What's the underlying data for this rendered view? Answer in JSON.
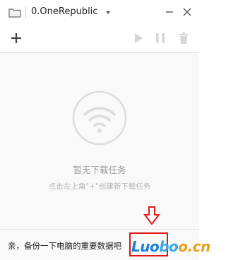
{
  "window": {
    "title": "0.OneRepublic",
    "icons": {
      "folder": "folder-icon",
      "dropdown": "caret-down-icon",
      "minimize": "minimize-icon",
      "close": "close-icon"
    }
  },
  "toolbar": {
    "add_icon": "plus-icon",
    "play_icon": "play-icon",
    "pause_icon": "pause-icon",
    "delete_icon": "trash-icon"
  },
  "empty_state": {
    "icon": "wifi-icon",
    "title": "暂无下载任务",
    "hint": "点击左上角\"+\"创建新下载任务"
  },
  "footer": {
    "text": "亲，备份一下电脑的重要数据吧"
  },
  "annotation": {
    "arrow_icon": "arrow-down-icon",
    "highlight_color": "#e01818"
  },
  "watermark": {
    "part1": "Luo",
    "part2": "bo",
    "part3": "o.cn"
  },
  "colors": {
    "accent_red": "#e01818",
    "muted_text": "#9a9a9a",
    "hint_text": "#b3b3b3"
  }
}
